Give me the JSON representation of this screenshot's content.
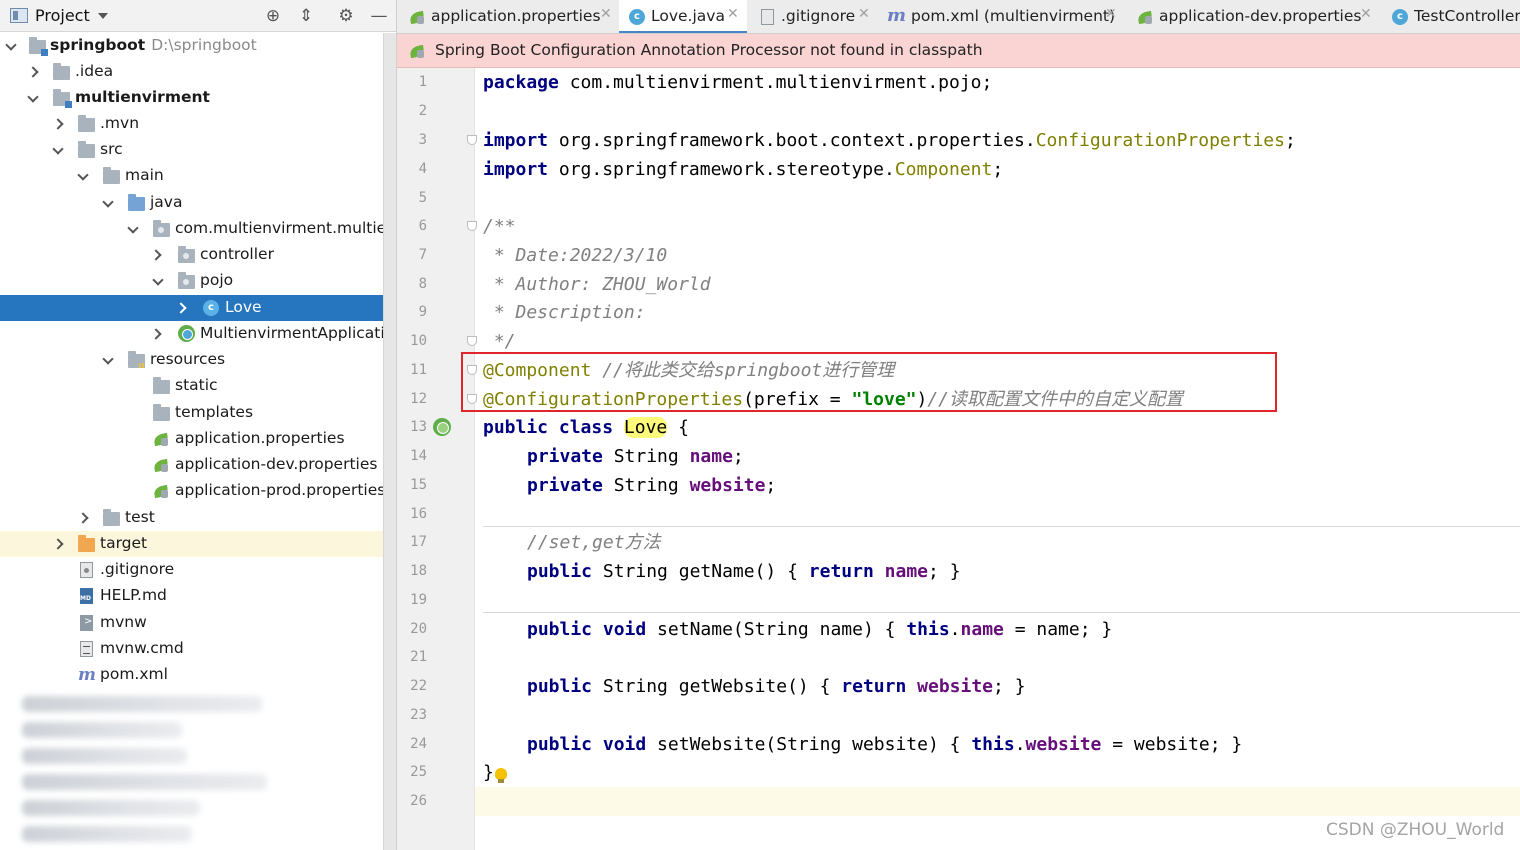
{
  "project_panel": {
    "title": "Project",
    "tree": [
      {
        "label": "springboot",
        "path": "D:\\springboot"
      },
      {
        "label": ".idea"
      },
      {
        "label": "multienvirment"
      },
      {
        "label": ".mvn"
      },
      {
        "label": "src"
      },
      {
        "label": "main"
      },
      {
        "label": "java"
      },
      {
        "label": "com.multienvirment.multienvi"
      },
      {
        "label": "controller"
      },
      {
        "label": "pojo"
      },
      {
        "label": "Love"
      },
      {
        "label": "MultienvirmentApplication"
      },
      {
        "label": "resources"
      },
      {
        "label": "static"
      },
      {
        "label": "templates"
      },
      {
        "label": "application.properties"
      },
      {
        "label": "application-dev.properties"
      },
      {
        "label": "application-prod.properties"
      },
      {
        "label": "test"
      },
      {
        "label": "target"
      },
      {
        "label": ".gitignore"
      },
      {
        "label": "HELP.md"
      },
      {
        "label": "mvnw"
      },
      {
        "label": "mvnw.cmd"
      },
      {
        "label": "pom.xml"
      }
    ]
  },
  "tabs": [
    {
      "label": "application.properties"
    },
    {
      "label": "Love.java"
    },
    {
      "label": ".gitignore"
    },
    {
      "label": "pom.xml (multienvirment)"
    },
    {
      "label": "application-dev.properties"
    },
    {
      "label": "TestController."
    }
  ],
  "banner": {
    "text": "Spring Boot Configuration Annotation Processor not found in classpath"
  },
  "editor": {
    "line_numbers": [
      "1",
      "2",
      "3",
      "4",
      "5",
      "6",
      "7",
      "8",
      "9",
      "10",
      "11",
      "12",
      "13",
      "14",
      "15",
      "16",
      "17",
      "18",
      "19",
      "20",
      "21",
      "22",
      "23",
      "24",
      "25",
      "26"
    ],
    "code": {
      "l1_kw": "package",
      "l1_rest": " com.multienvirment.multienvirment.pojo;",
      "l3_kw": "import",
      "l3_pkg": " org.springframework.boot.context.properties.",
      "l3_cls": "ConfigurationProperties",
      "l3_end": ";",
      "l4_kw": "import",
      "l4_pkg": " org.springframework.stereotype.",
      "l4_cls": "Component",
      "l4_end": ";",
      "l6": "/**",
      "l7": " * Date:2022/3/10",
      "l8": " * Author: ZHOU_World",
      "l9": " * Description:",
      "l10": " */",
      "l11_ann": "@Component",
      "l11_cm": " //将此类交给springboot进行管理",
      "l12_ann": "@ConfigurationProperties",
      "l12_a": "(prefix = ",
      "l12_str": "\"love\"",
      "l12_b": ")",
      "l12_cm": "//读取配置文件中的自定义配置",
      "l13_kw": "public class",
      "l13_name": "Love",
      "l13_end": " {",
      "l14_kw": "private",
      "l14_type": " String ",
      "l14_fld": "name",
      "l14_end": ";",
      "l15_kw": "private",
      "l15_type": " String ",
      "l15_fld": "website",
      "l15_end": ";",
      "l17": "//set,get方法",
      "l18_kw": "public",
      "l18_a": " String getName() { ",
      "l18_kw2": "return",
      "l18_sp": " ",
      "l18_fld": "name",
      "l18_end": "; }",
      "l20_kw": "public void",
      "l20_a": " setName(String name) { ",
      "l20_kw2": "this",
      "l20_dot": ".",
      "l20_fld": "name",
      "l20_end": " = name; }",
      "l22_kw": "public",
      "l22_a": " String getWebsite() { ",
      "l22_kw2": "return",
      "l22_sp": " ",
      "l22_fld": "website",
      "l22_end": "; }",
      "l24_kw": "public void",
      "l24_a": " setWebsite(String website) { ",
      "l24_kw2": "this",
      "l24_dot": ".",
      "l24_fld": "website",
      "l24_end": " = website; }",
      "l25": "}"
    }
  },
  "watermark": "CSDN @ZHOU_World",
  "colors": {
    "selection": "#2675bf",
    "banner_bg": "#f9d4d3",
    "highlight_box": "#e0262b",
    "keyword": "#000080",
    "annotation": "#808000",
    "comment": "#808080",
    "string": "#008000",
    "field": "#660e7a"
  }
}
